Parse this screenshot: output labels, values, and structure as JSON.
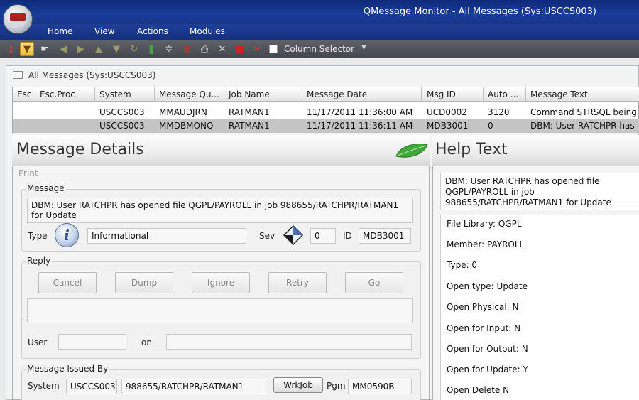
{
  "window": {
    "title": "QMessage Monitor - All Messages (Sys:USCCS003)"
  },
  "menu": [
    "Home",
    "View",
    "Actions",
    "Modules"
  ],
  "toolbar": {
    "column_selector_label": "Column Selector"
  },
  "panel": {
    "title": "All Messages (Sys:USCCS003)"
  },
  "grid": {
    "columns": [
      "Esc",
      "Esc.Proc",
      "System",
      "Message Qu...",
      "Job Name",
      "Message Date",
      "Msg ID",
      "Auto ...",
      "Message Text"
    ],
    "rows": [
      [
        "",
        "",
        "USCCS003",
        "MMAUDJRN",
        "RATMAN1",
        "11/17/2011 11:36:00 AM",
        "UCD0002",
        "3120",
        "Command STRSQL being"
      ],
      [
        "",
        "",
        "USCCS003",
        "MMDBMONQ",
        "RATMAN1",
        "11/17/2011 11:36:11 AM",
        "MDB3001",
        "0",
        "DBM: User RATCHPR has"
      ]
    ],
    "selected_row": 1
  },
  "details": {
    "title": "Message Details",
    "print": "Print",
    "message_group": "Message",
    "message_text": "DBM: User RATCHPR has opened file QGPL/PAYROLL in job 988655/RATCHPR/RATMAN1 for Update",
    "type_label": "Type",
    "type_value": "Informational",
    "sev_label": "Sev",
    "sev_value": "0",
    "id_label": "ID",
    "id_value": "MDB3001",
    "reply_group": "Reply",
    "reply_buttons": [
      "Cancel",
      "Dump",
      "Ignore",
      "Retry",
      "Go"
    ],
    "reply_text": "",
    "user_label": "User",
    "user_value": "",
    "on_label": "on",
    "on_value": "",
    "issued_group": "Message Issued By",
    "system_label": "System",
    "system_value": "USCCS003",
    "job_value": "988655/RATCHPR/RATMAN1",
    "wrkjob_label": "WrkJob",
    "pgm_label": "Pgm",
    "pgm_value": "MM0590B"
  },
  "help": {
    "title": "Help Text",
    "message": "DBM: User RATCHPR has opened file QGPL/PAYROLL in job 988655/RATCHPR/RATMAN1 for Update",
    "lines": [
      "File Library: QGPL",
      "Member: PAYROLL",
      "Type: 0",
      "Open type: Update",
      "Open Physical: N",
      "Open for Input: N",
      "Open for Output: N",
      "Open for Update: Y",
      "Open Delete N"
    ]
  },
  "icons": {
    "toolbar": [
      "key-icon",
      "filter-icon",
      "hand-icon",
      "arrow-left-icon",
      "arrow-right-icon",
      "arrow-up-icon",
      "arrow-down-icon",
      "refresh-icon",
      "bookmark-icon",
      "tools-icon",
      "printer-stack-icon",
      "printer-icon",
      "wrench-icon",
      "delete-record-icon",
      "scissors-icon"
    ],
    "accent": "#1a3d9a",
    "selection": "#c5c5c5"
  }
}
